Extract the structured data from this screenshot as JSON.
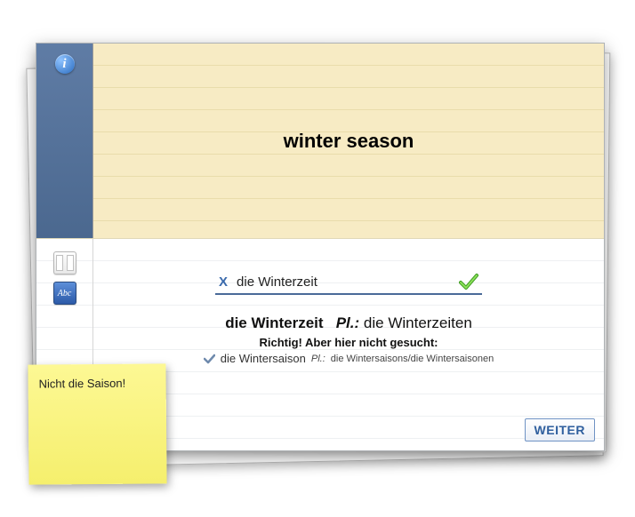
{
  "card": {
    "prompt": "winter season",
    "info_label": "i",
    "tools": {
      "split_name": "split-view-icon",
      "dict_name": "dictionary-icon",
      "dict_text": "Abc"
    },
    "answer": {
      "clear_mark": "X",
      "user_input": "die Winterzeit",
      "correct": true
    },
    "solution": {
      "main": "die Winterzeit",
      "plural_label": "Pl.:",
      "plural_value": "die Winterzeiten"
    },
    "feedback": "Richtig! Aber hier nicht gesucht:",
    "alternative": {
      "word": "die Wintersaison",
      "plural_label": "Pl.:",
      "plural_value": "die Wintersaisons/die Wintersaisonen"
    },
    "next_button": "WEITER"
  },
  "sticky_note": "Nicht die Saison!"
}
